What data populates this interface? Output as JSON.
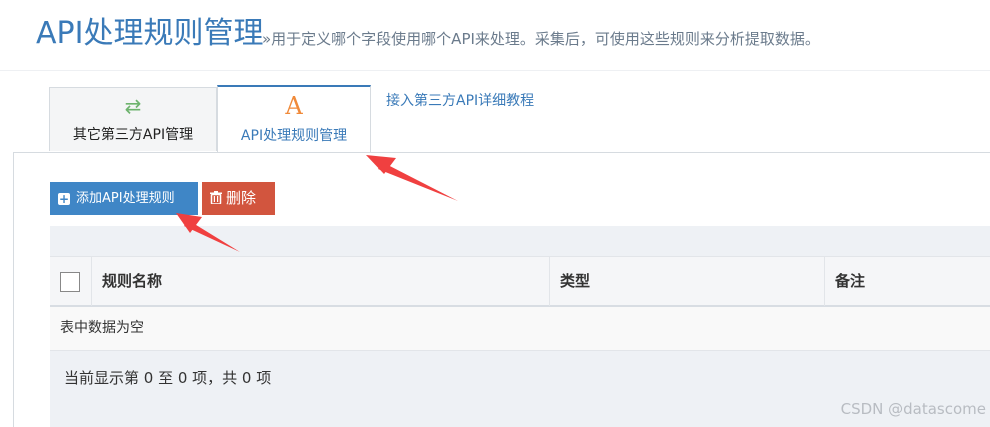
{
  "header": {
    "title": "API处理规则管理",
    "subtitle": "»用于定义哪个字段使用哪个API来处理。采集后，可使用这些规则来分析提取数据。"
  },
  "tabs": [
    {
      "label": "其它第三方API管理",
      "icon": "exchange-arrows-icon",
      "icon_glyph": "⇄",
      "icon_color": "#6db36d",
      "active": false
    },
    {
      "label": "API处理规则管理",
      "icon": "letter-a-icon",
      "icon_glyph": "A",
      "icon_color": "#f08a3a",
      "active": true
    }
  ],
  "tutorial_link": "接入第三方API详细教程",
  "toolbar": {
    "add_label": "添加API处理规则",
    "delete_label": "删除",
    "add_color": "#3f86c6",
    "delete_color": "#d2553e"
  },
  "table": {
    "columns": [
      "规则名称",
      "类型",
      "备注"
    ],
    "empty_text": "表中数据为空",
    "info_text": "当前显示第 0 至 0 项，共 0 项"
  },
  "watermark": "CSDN @datascome",
  "colors": {
    "accent": "#3a7ab8",
    "annotation_arrow": "#f04040"
  }
}
